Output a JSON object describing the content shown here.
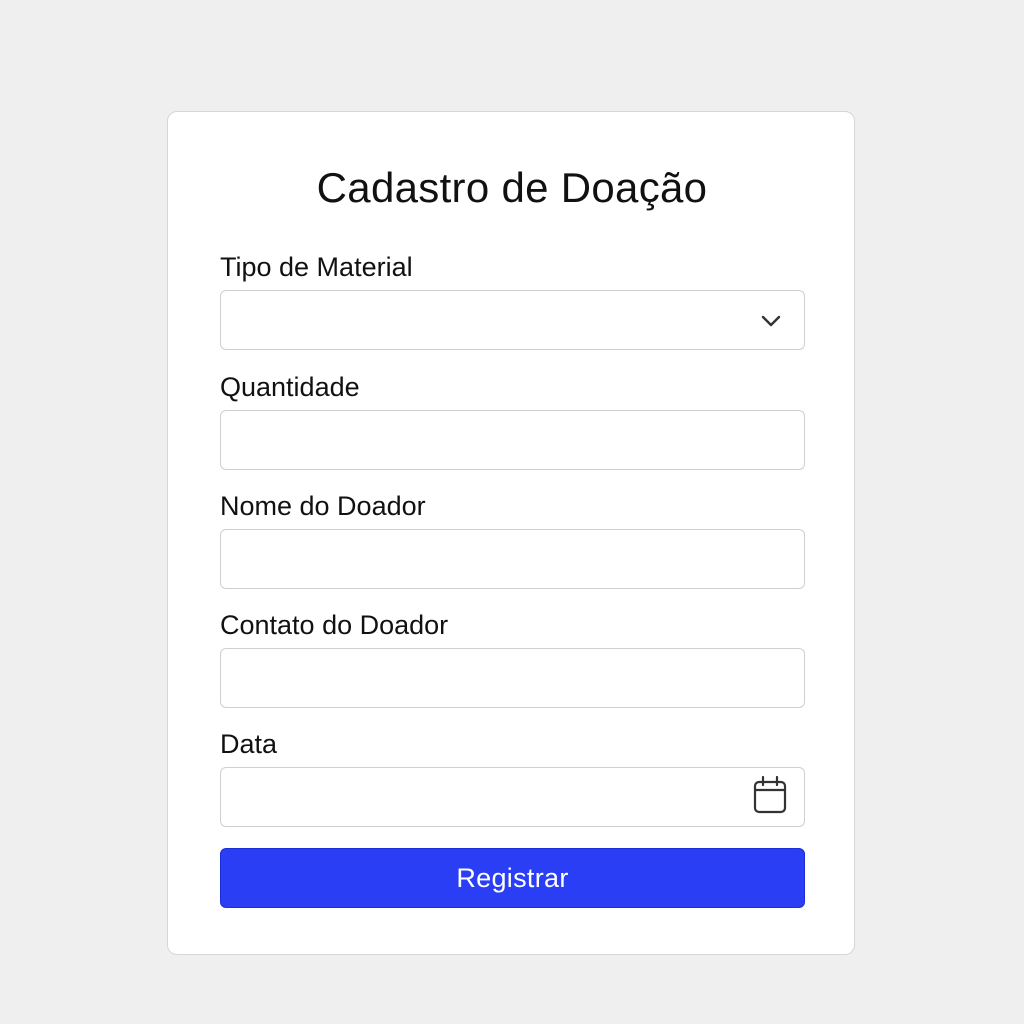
{
  "form": {
    "title": "Cadastro de Doação",
    "fields": {
      "material_type": {
        "label": "Tipo de Material",
        "value": ""
      },
      "quantity": {
        "label": "Quantidade",
        "value": ""
      },
      "donor_name": {
        "label": "Nome do Doador",
        "value": ""
      },
      "donor_contact": {
        "label": "Contato do Doador",
        "value": ""
      },
      "date": {
        "label": "Data",
        "value": ""
      }
    },
    "submit_label": "Registrar"
  },
  "icons": {
    "select_arrow": "chevron-down-icon",
    "date_picker": "calendar-icon"
  },
  "colors": {
    "background": "#efefef",
    "card": "#ffffff",
    "accent": "#2a3ff5",
    "border": "#cfcfcf"
  }
}
